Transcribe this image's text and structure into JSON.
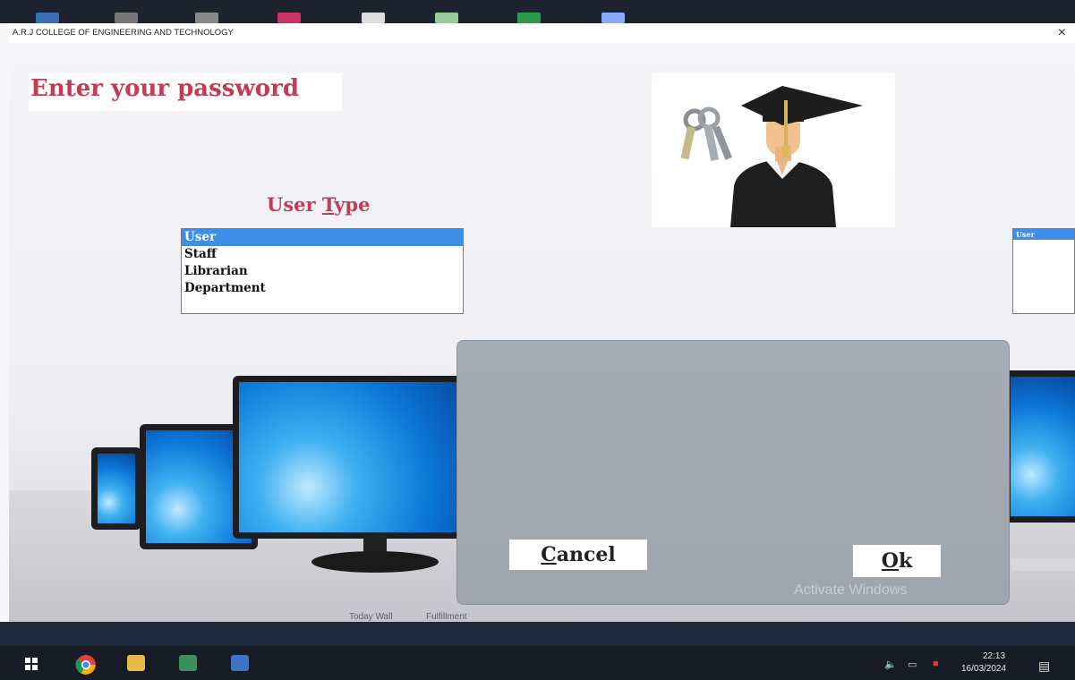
{
  "window": {
    "title": "A.R.J COLLEGE OF ENGINEERING AND TECHNOLOGY",
    "close_glyph": "×"
  },
  "main": {
    "heading": "Enter your password",
    "user_type_label_pre": "User ",
    "user_type_label_underlined": "T",
    "user_type_label_post": "ype",
    "user_type_options": [
      "User",
      "Staff",
      "Librarian",
      "Department"
    ],
    "selected_option": "User",
    "secondary_list_selected": "User",
    "under_text_1": "Today Wall",
    "under_text_2": "Fulfillment"
  },
  "dialog": {
    "cancel_underlined": "C",
    "cancel_rest": "ancel",
    "ok_underlined": "O",
    "ok_rest": "k",
    "watermark": "Activate Windows"
  },
  "taskbar": {
    "time": "22:13",
    "date": "16/03/2024"
  },
  "colors": {
    "accent_heading": "#c23c55",
    "selection": "#3c8ee6",
    "taskbar": "#161b24"
  }
}
